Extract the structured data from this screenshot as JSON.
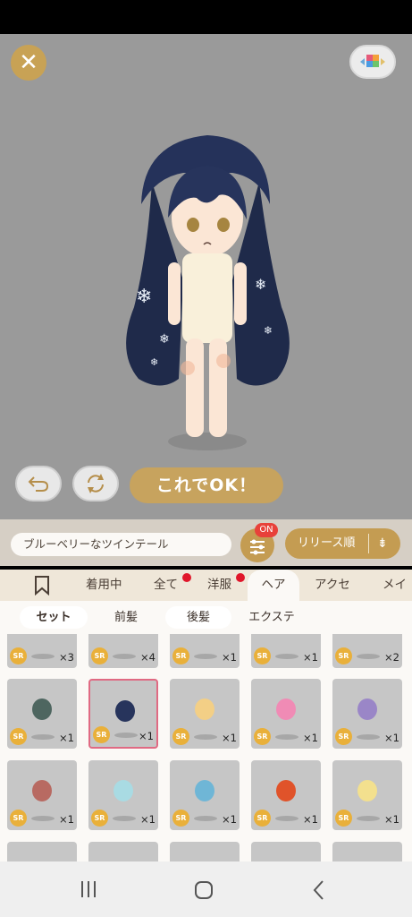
{
  "actions": {
    "ok_label": "これでOK！"
  },
  "filter": {
    "item_name": "ブルーベリーなツインテール",
    "on_badge": "ON",
    "sort_label": "リリース順"
  },
  "tabs": [
    {
      "label": "着用中"
    },
    {
      "label": "全て"
    },
    {
      "label": "洋服"
    },
    {
      "label": "ヘア"
    },
    {
      "label": "アクセ"
    },
    {
      "label": "メイ"
    }
  ],
  "subtabs": [
    {
      "label": "セット"
    },
    {
      "label": "前髪"
    },
    {
      "label": "後髪"
    },
    {
      "label": "エクステ"
    }
  ],
  "items": {
    "rarity": "SR",
    "row1": [
      "×3",
      "×4",
      "×1",
      "×1",
      "×2"
    ],
    "row2": [
      "×1",
      "×1",
      "×1",
      "×1",
      "×1"
    ],
    "row3": [
      "×1",
      "×1",
      "×1",
      "×1",
      "×1"
    ]
  }
}
